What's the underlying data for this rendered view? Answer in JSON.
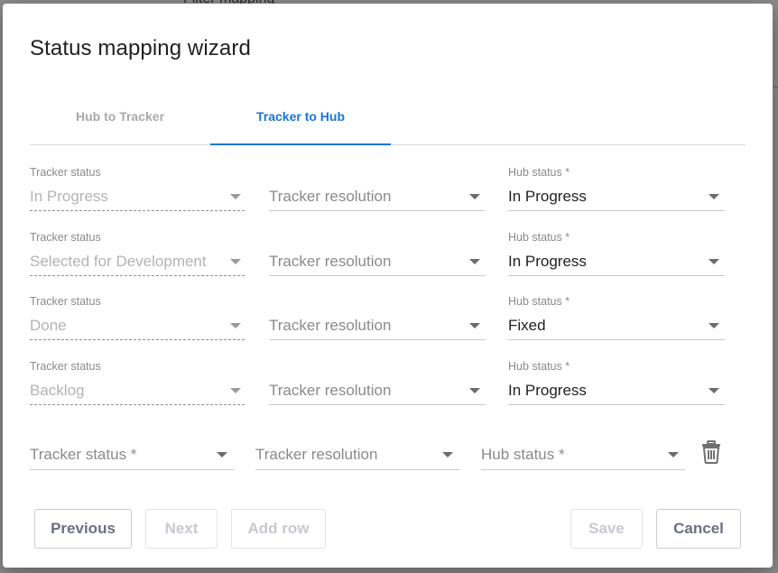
{
  "background": {
    "partial_text": "Filter mapping"
  },
  "dialog": {
    "title": "Status mapping wizard",
    "tabs": [
      {
        "label": "Hub to Tracker",
        "active": false
      },
      {
        "label": "Tracker to Hub",
        "active": true
      }
    ],
    "rows": [
      {
        "tracker_status_label": "Tracker status",
        "tracker_status": "In Progress",
        "tracker_resolution": "Tracker resolution",
        "hub_status_label": "Hub status *",
        "hub_status": "In Progress"
      },
      {
        "tracker_status_label": "Tracker status",
        "tracker_status": "Selected for Development",
        "tracker_resolution": "Tracker resolution",
        "hub_status_label": "Hub status *",
        "hub_status": "In Progress"
      },
      {
        "tracker_status_label": "Tracker status",
        "tracker_status": "Done",
        "tracker_resolution": "Tracker resolution",
        "hub_status_label": "Hub status *",
        "hub_status": "Fixed"
      },
      {
        "tracker_status_label": "Tracker status",
        "tracker_status": "Backlog",
        "tracker_resolution": "Tracker resolution",
        "hub_status_label": "Hub status *",
        "hub_status": "In Progress"
      }
    ],
    "new_row": {
      "tracker_status_placeholder": "Tracker status *",
      "tracker_resolution_placeholder": "Tracker resolution",
      "hub_status_placeholder": "Hub status *"
    },
    "buttons": {
      "previous": "Previous",
      "next": "Next",
      "add_row": "Add row",
      "save": "Save",
      "cancel": "Cancel"
    },
    "colors": {
      "accent": "#1976d2",
      "disabled_text": "#b3b3b3"
    }
  }
}
